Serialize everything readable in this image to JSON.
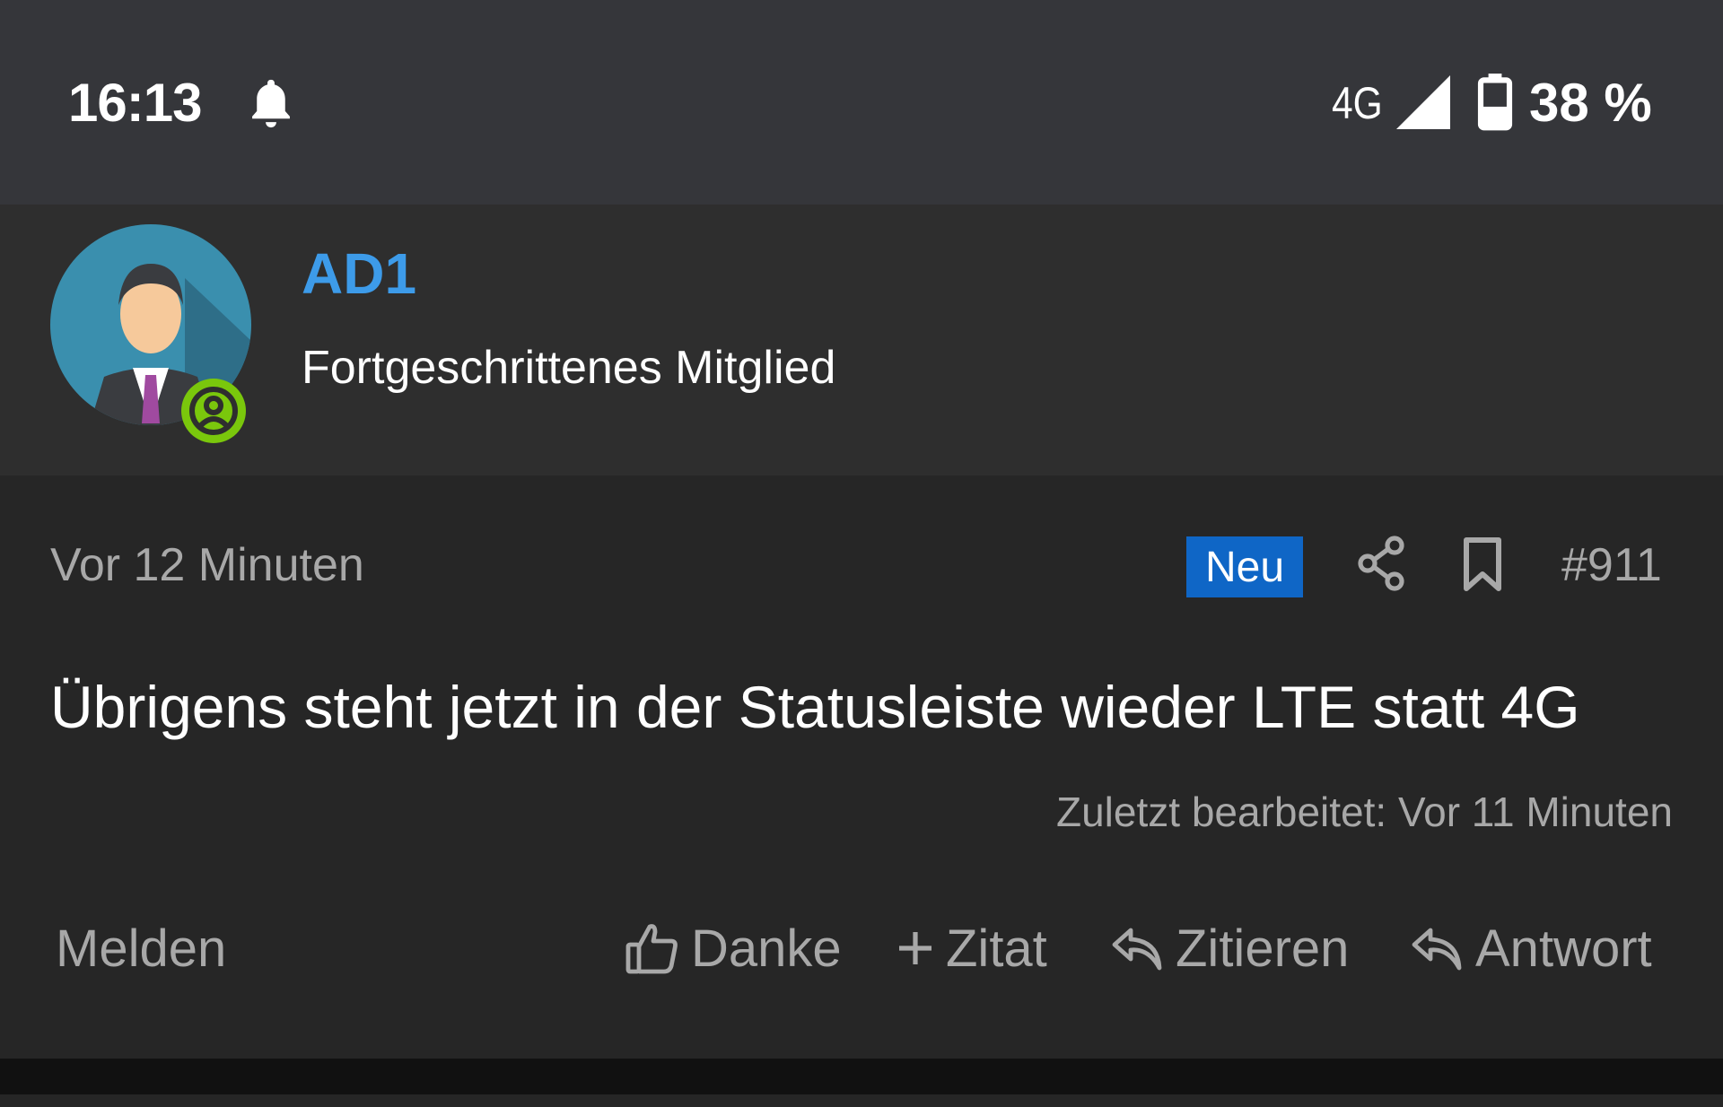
{
  "status_bar": {
    "time": "16:13",
    "network": "4G",
    "battery": "38 %",
    "icons": [
      "bell-icon",
      "signal-icon",
      "battery-icon"
    ]
  },
  "user": {
    "name": "AD1",
    "rank": "Fortgeschrittenes Mitglied",
    "name_color": "#3d9be9",
    "online_color": "#7ac70c"
  },
  "post": {
    "time": "Vor 12 Minuten",
    "badge": "Neu",
    "badge_color": "#0f66c6",
    "number": "#911",
    "body": "Übrigens steht jetzt in der Statusleiste wieder LTE statt 4G",
    "edited": "Zuletzt bearbeitet: Vor 11 Minuten"
  },
  "actions": {
    "report": "Melden",
    "thanks": "Danke",
    "multiquote": "Zitat",
    "quote": "Zitieren",
    "reply": "Antwort"
  }
}
